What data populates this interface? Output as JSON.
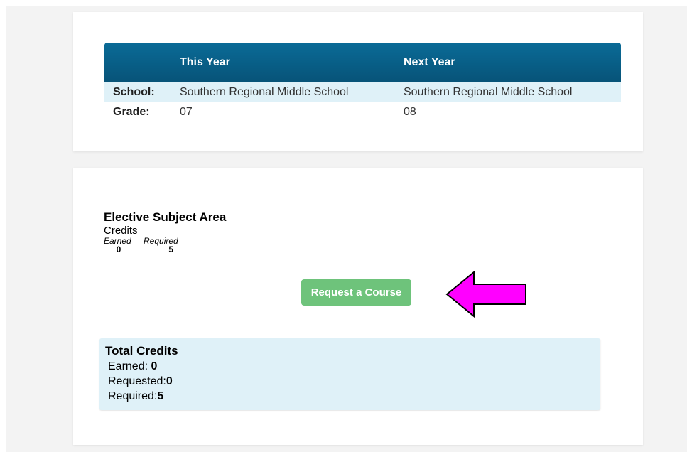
{
  "schedule": {
    "headers": {
      "label": "",
      "this_year": "This Year",
      "next_year": "Next Year"
    },
    "rows": [
      {
        "label": "School:",
        "this_year": "Southern Regional Middle School",
        "next_year": "Southern Regional Middle School"
      },
      {
        "label": "Grade:",
        "this_year": "07",
        "next_year": "08"
      }
    ]
  },
  "elective": {
    "title": "Elective Subject Area",
    "credits_label": "Credits",
    "earned_label": "Earned",
    "required_label": "Required",
    "earned_value": "0",
    "required_value": "5"
  },
  "request_button": {
    "label": "Request a Course"
  },
  "annotation": {
    "arrow_color": "#ff00ff",
    "arrow_icon": "left-arrow-icon"
  },
  "totals": {
    "title": "Total Credits",
    "earned_label": "Earned: ",
    "earned_value": "0",
    "requested_label": "Requested:",
    "requested_value": "0",
    "required_label": "Required:",
    "required_value": "5"
  },
  "colors": {
    "header_bg": "#0a6b97",
    "row_highlight": "#dff1f8",
    "button_green": "#6ec37b",
    "totals_bg": "#dff1f8"
  }
}
